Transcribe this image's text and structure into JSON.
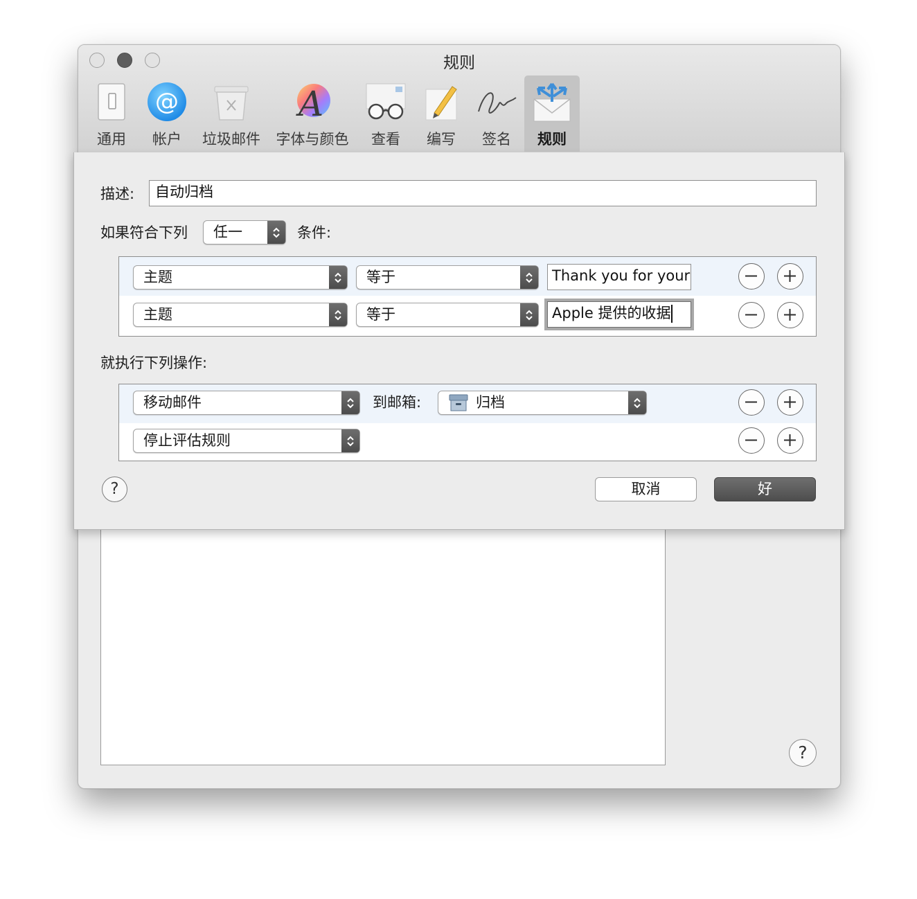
{
  "window": {
    "title": "规则"
  },
  "toolbar": {
    "items": [
      {
        "label": "通用",
        "icon": "switch-icon"
      },
      {
        "label": "帐户",
        "icon": "at-sign-icon"
      },
      {
        "label": "垃圾邮件",
        "icon": "junk-bin-icon"
      },
      {
        "label": "字体与颜色",
        "icon": "font-icon"
      },
      {
        "label": "查看",
        "icon": "glasses-icon"
      },
      {
        "label": "编写",
        "icon": "pencil-icon"
      },
      {
        "label": "签名",
        "icon": "signature-icon"
      },
      {
        "label": "规则",
        "icon": "rules-envelope-icon"
      }
    ],
    "selected": "规则"
  },
  "sheet": {
    "description_label": "描述:",
    "description_value": "自动归档",
    "if_label": "如果符合下列",
    "match_value": "任一",
    "conditions_label": "条件:",
    "conditions": [
      {
        "field": "主题",
        "operator": "等于",
        "value": "Thank you for your"
      },
      {
        "field": "主题",
        "operator": "等于",
        "value": "Apple 提供的收据"
      }
    ],
    "actions_label": "就执行下列操作:",
    "actions": [
      {
        "action": "移动邮件",
        "target_label": "到邮箱:",
        "mailbox": "归档"
      },
      {
        "action": "停止评估规则"
      }
    ],
    "help": "?",
    "cancel_label": "取消",
    "ok_label": "好"
  },
  "main": {
    "help": "?"
  },
  "colors": {
    "accent_button": "#555555",
    "focus_ring": "#9a9a9a",
    "row_alt": "#eef4fb"
  }
}
